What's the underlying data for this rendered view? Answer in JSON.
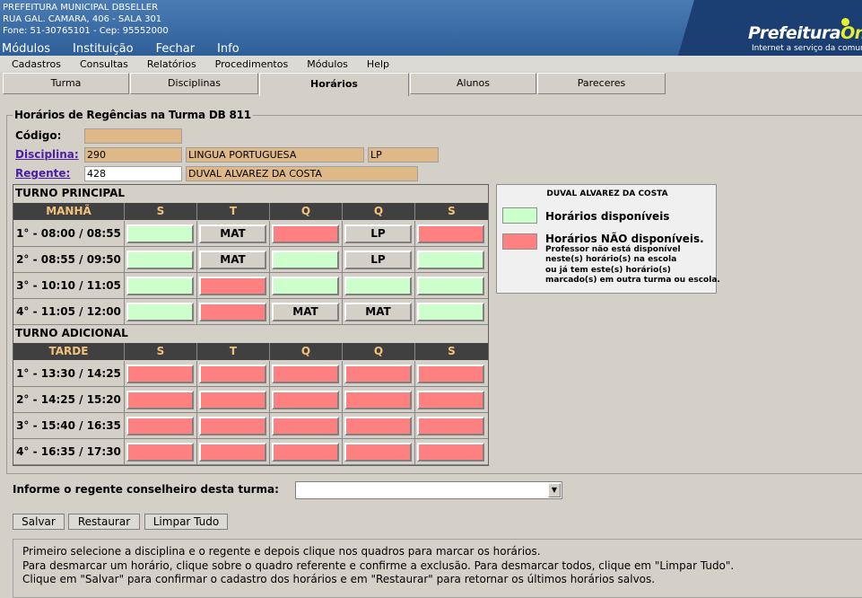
{
  "header": {
    "org": "PREFEITURA MUNICIPAL DBSELLER",
    "address": "RUA GAL. CAMARA, 406 - SALA 301",
    "contact": "Fone: 51-30765101  -  Cep: 95552000",
    "menu": [
      "Módulos",
      "Instituição",
      "Fechar",
      "Info"
    ],
    "logo_main": "Prefeitura",
    "logo_on": "On",
    "logo_sub": "Internet a serviço da comunidade"
  },
  "menubar": [
    "Cadastros",
    "Consultas",
    "Relatórios",
    "Procedimentos",
    "Módulos",
    "Help"
  ],
  "tabs": [
    "Turma",
    "Disciplinas",
    "Horários",
    "Alunos",
    "Pareceres"
  ],
  "active_tab": "Horários",
  "form": {
    "legend": "Horários de Regências na Turma DB 811",
    "codigo_label": "Código:",
    "codigo_value": "",
    "disciplina_label": "Disciplina:",
    "disciplina_code": "290",
    "disciplina_name": "LINGUA PORTUGUESA",
    "disciplina_abbr": "LP",
    "regente_label": "Regente:",
    "regente_code": "428",
    "regente_name": "DUVAL ALVAREZ DA COSTA"
  },
  "colors": {
    "available": "#ccffcc",
    "unavailable": "#ff8080",
    "neutral": "#d4d0c8",
    "field": "#deb887",
    "header_text": "#f3c27c"
  },
  "grid": {
    "days": [
      "S",
      "T",
      "Q",
      "Q",
      "S"
    ],
    "principal": {
      "title": "TURNO PRINCIPAL",
      "period": "MANHÃ",
      "rows": [
        {
          "time": "1° - 08:00 / 08:55",
          "cells": [
            {
              "s": "available",
              "t": ""
            },
            {
              "s": "neutral",
              "t": "MAT"
            },
            {
              "s": "unavailable",
              "t": ""
            },
            {
              "s": "neutral",
              "t": "LP"
            },
            {
              "s": "unavailable",
              "t": ""
            }
          ]
        },
        {
          "time": "2° - 08:55 / 09:50",
          "cells": [
            {
              "s": "available",
              "t": ""
            },
            {
              "s": "neutral",
              "t": "MAT"
            },
            {
              "s": "available",
              "t": ""
            },
            {
              "s": "neutral",
              "t": "LP"
            },
            {
              "s": "available",
              "t": ""
            }
          ]
        },
        {
          "time": "3° - 10:10 / 11:05",
          "cells": [
            {
              "s": "available",
              "t": ""
            },
            {
              "s": "unavailable",
              "t": ""
            },
            {
              "s": "available",
              "t": ""
            },
            {
              "s": "available",
              "t": ""
            },
            {
              "s": "available",
              "t": ""
            }
          ]
        },
        {
          "time": "4° - 11:05 / 12:00",
          "cells": [
            {
              "s": "available",
              "t": ""
            },
            {
              "s": "unavailable",
              "t": ""
            },
            {
              "s": "neutral",
              "t": "MAT"
            },
            {
              "s": "neutral",
              "t": "MAT"
            },
            {
              "s": "available",
              "t": ""
            }
          ]
        }
      ]
    },
    "adicional": {
      "title": "TURNO ADICIONAL",
      "period": "TARDE",
      "rows": [
        {
          "time": "1° - 13:30 / 14:25",
          "cells": [
            {
              "s": "unavailable",
              "t": ""
            },
            {
              "s": "unavailable",
              "t": ""
            },
            {
              "s": "unavailable",
              "t": ""
            },
            {
              "s": "unavailable",
              "t": ""
            },
            {
              "s": "unavailable",
              "t": ""
            }
          ]
        },
        {
          "time": "2° - 14:25 / 15:20",
          "cells": [
            {
              "s": "unavailable",
              "t": ""
            },
            {
              "s": "unavailable",
              "t": ""
            },
            {
              "s": "unavailable",
              "t": ""
            },
            {
              "s": "unavailable",
              "t": ""
            },
            {
              "s": "unavailable",
              "t": ""
            }
          ]
        },
        {
          "time": "3° - 15:40 / 16:35",
          "cells": [
            {
              "s": "unavailable",
              "t": ""
            },
            {
              "s": "unavailable",
              "t": ""
            },
            {
              "s": "unavailable",
              "t": ""
            },
            {
              "s": "unavailable",
              "t": ""
            },
            {
              "s": "unavailable",
              "t": ""
            }
          ]
        },
        {
          "time": "4° - 16:35 / 17:30",
          "cells": [
            {
              "s": "unavailable",
              "t": ""
            },
            {
              "s": "unavailable",
              "t": ""
            },
            {
              "s": "unavailable",
              "t": ""
            },
            {
              "s": "unavailable",
              "t": ""
            },
            {
              "s": "unavailable",
              "t": ""
            }
          ]
        }
      ]
    }
  },
  "legend_box": {
    "name": "DUVAL ALVAREZ DA COSTA",
    "available": "Horários disponíveis",
    "unavailable": "Horários NÃO disponíveis.",
    "note": [
      "Professor não está disponível",
      "neste(s) horário(s) na escola",
      "ou já tem este(s) horário(s)",
      "marcado(s) em outra turma ou escola."
    ]
  },
  "regente_conselheiro": {
    "label": "Informe o regente conselheiro desta turma:",
    "value": ""
  },
  "buttons": {
    "save": "Salvar",
    "restore": "Restaurar",
    "clear": "Limpar Tudo"
  },
  "help": [
    "Primeiro selecione a disciplina e o regente e depois clique nos quadros para marcar os horários.",
    "Para desmarcar um horário, clique sobre o quadro referente e confirme a exclusão. Para desmarcar todos, clique em \"Limpar Tudo\".",
    "Clique em \"Salvar\" para confirmar o cadastro dos horários e em \"Restaurar\" para retornar os últimos horários salvos."
  ]
}
